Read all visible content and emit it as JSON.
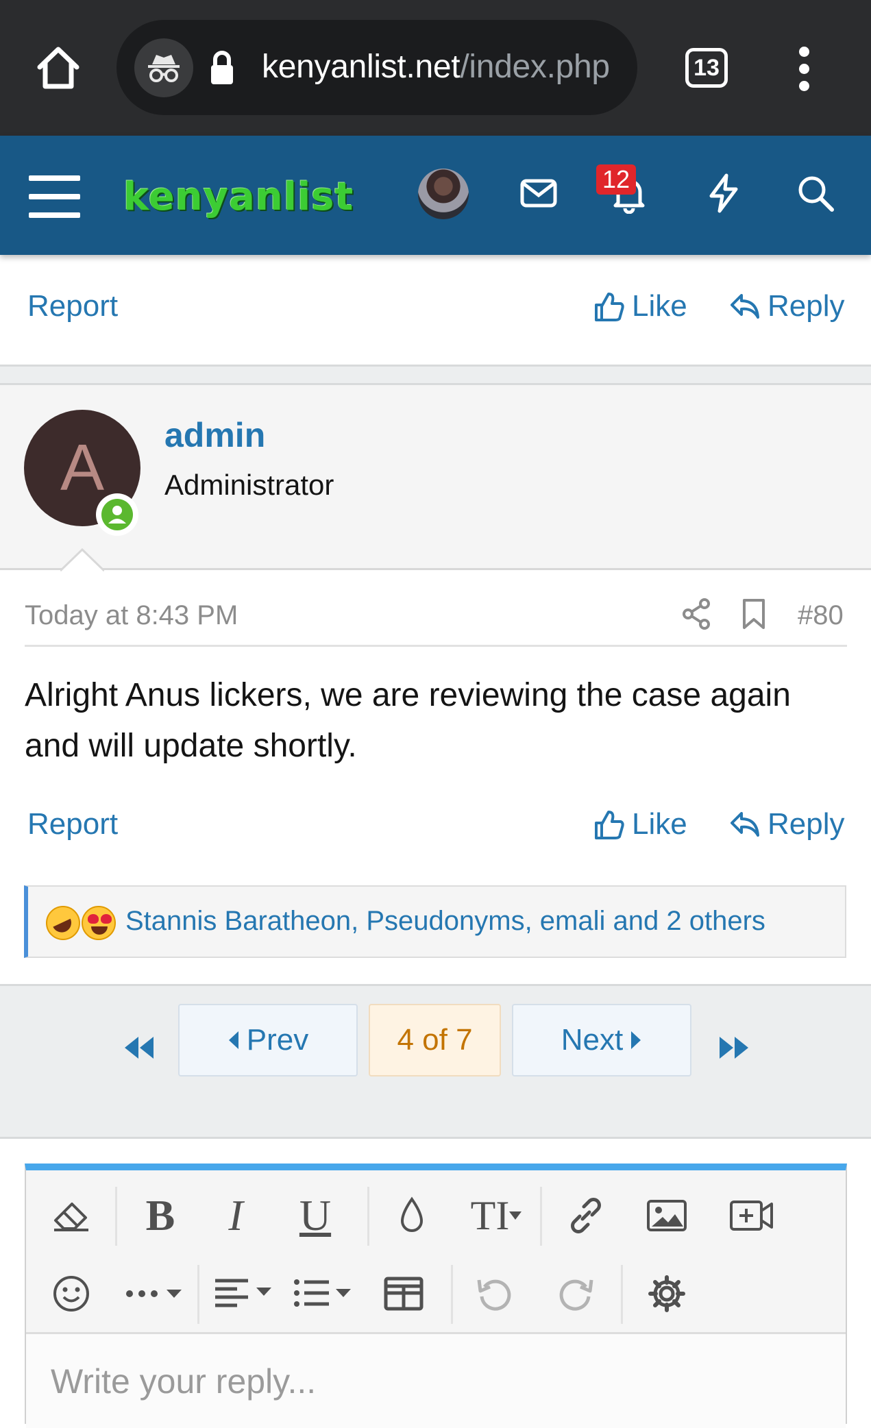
{
  "browser": {
    "url_domain": "kenyanlist.net",
    "url_path": "/index.php",
    "tab_count": "13"
  },
  "header": {
    "logo_text": "kenyanlist",
    "notification_count": "12",
    "colors": {
      "background": "#185886",
      "logo": "#3ccc34",
      "badge": "#e0262b"
    }
  },
  "prev_post_actions": {
    "report": "Report",
    "like": "Like",
    "reply": "Reply"
  },
  "post": {
    "avatar_letter": "A",
    "username": "admin",
    "user_title": "Administrator",
    "date": "Today at 8:43 PM",
    "number": "#80",
    "body": "Alright Anus lickers, we are reviewing the case again and will update shortly.",
    "actions": {
      "report": "Report",
      "like": "Like",
      "reply": "Reply"
    },
    "reactions": {
      "icons": [
        "rofl-emoji",
        "heart-eyes-emoji"
      ],
      "text": "Stannis Baratheon, Pseudonyms, emali and 2 others"
    }
  },
  "pagination": {
    "prev": "Prev",
    "current": "4 of 7",
    "next": "Next"
  },
  "editor": {
    "toolbar_icons": [
      "eraser-icon",
      "bold-icon",
      "italic-icon",
      "underline-icon",
      "text-color-icon",
      "font-size-icon",
      "link-icon",
      "image-icon",
      "video-icon",
      "smilie-icon",
      "more-icon",
      "align-icon",
      "list-icon",
      "table-icon",
      "undo-icon",
      "redo-icon",
      "settings-icon"
    ],
    "bold": "B",
    "italic": "I",
    "underline": "U",
    "font_size": "TI",
    "placeholder": "Write your reply..."
  },
  "colors": {
    "link": "#2577b1",
    "current_page": "#c37403",
    "editor_accent": "#47a7eb",
    "online": "#5bb82f"
  }
}
